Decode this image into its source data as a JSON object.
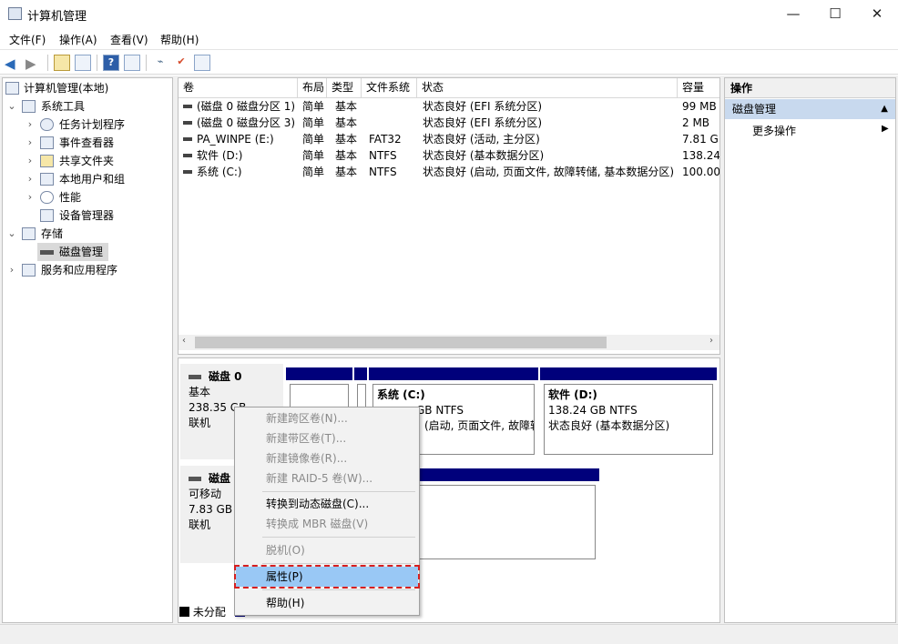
{
  "window": {
    "title": "计算机管理",
    "minimize": "—",
    "maximize": "☐",
    "close": "✕"
  },
  "menu": [
    "文件(F)",
    "操作(A)",
    "查看(V)",
    "帮助(H)"
  ],
  "tree": {
    "root": "计算机管理(本地)",
    "system_tools": "系统工具",
    "task_scheduler": "任务计划程序",
    "event_viewer": "事件查看器",
    "shared_folders": "共享文件夹",
    "local_users": "本地用户和组",
    "performance": "性能",
    "device_manager": "设备管理器",
    "storage": "存储",
    "disk_management": "磁盘管理",
    "services": "服务和应用程序"
  },
  "volume_table": {
    "columns": [
      "卷",
      "布局",
      "类型",
      "文件系统",
      "状态",
      "容量"
    ],
    "rows": [
      [
        "(磁盘 0 磁盘分区 1)",
        "简单",
        "基本",
        "",
        "状态良好 (EFI 系统分区)",
        "99 MB"
      ],
      [
        "(磁盘 0 磁盘分区 3)",
        "简单",
        "基本",
        "",
        "状态良好 (EFI 系统分区)",
        "2 MB"
      ],
      [
        "PA_WINPE (E:)",
        "简单",
        "基本",
        "FAT32",
        "状态良好 (活动, 主分区)",
        "7.81 GE"
      ],
      [
        "软件 (D:)",
        "简单",
        "基本",
        "NTFS",
        "状态良好 (基本数据分区)",
        "138.24"
      ],
      [
        "系统 (C:)",
        "简单",
        "基本",
        "NTFS",
        "状态良好 (启动, 页面文件, 故障转储, 基本数据分区)",
        "100.00"
      ]
    ]
  },
  "disks": {
    "disk0": {
      "name": "磁盘 0",
      "type": "基本",
      "size": "238.35 GB",
      "status": "联机",
      "part_c": {
        "name": "系统 (C:)",
        "size": "GB NTFS",
        "status": "(启动, 页面文件, 故障转"
      },
      "part_d": {
        "name": "软件 (D:)",
        "size": "138.24 GB NTFS",
        "status": "状态良好 (基本数据分区)"
      }
    },
    "disk1": {
      "name": "磁盘",
      "type": "可移动",
      "size": "7.83 GB",
      "status": "联机"
    }
  },
  "legend": {
    "unallocated": "未分配"
  },
  "actions": {
    "header": "操作",
    "section": "磁盘管理",
    "more": "更多操作"
  },
  "context_menu": {
    "spanned": "新建跨区卷(N)...",
    "striped": "新建带区卷(T)...",
    "mirrored": "新建镜像卷(R)...",
    "raid5": "新建 RAID-5 卷(W)...",
    "to_dynamic": "转换到动态磁盘(C)...",
    "to_mbr": "转换成 MBR 磁盘(V)",
    "offline": "脱机(O)",
    "properties": "属性(P)",
    "help": "帮助(H)"
  },
  "colors": {
    "partition_bar": "#00007b",
    "highlight": "#99c8f5",
    "annotation": "#d61f1f"
  }
}
